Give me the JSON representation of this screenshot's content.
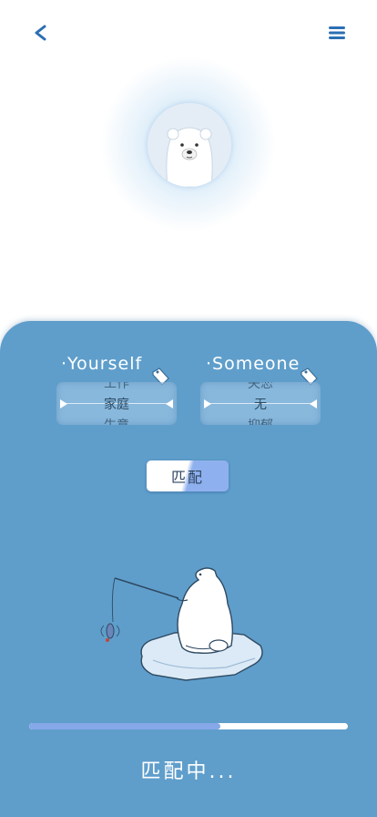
{
  "header": {
    "back_icon": "chevron-left-icon",
    "back_glyph": "<",
    "menu_icon": "hamburger-menu-icon"
  },
  "avatar": {
    "icon": "polar-bear-face-icon"
  },
  "pickers": {
    "yourself": {
      "label": "·Yourself",
      "items": [
        "工作",
        "家庭",
        "生意"
      ],
      "selected": "家庭"
    },
    "someone": {
      "label": "·Someone",
      "items": [
        "失恋",
        "无",
        "抑郁"
      ],
      "selected": "无"
    }
  },
  "match_button": {
    "label": "匹配"
  },
  "illustration": {
    "icon": "polar-bear-fishing-illustration"
  },
  "progress": {
    "value": 0.6
  },
  "status": {
    "text": "匹配中..."
  },
  "colors": {
    "accent": "#2b6fb3",
    "panel": "#5f9ecb",
    "progress_fill": "#86a7e8",
    "progress_track": "#ffffff"
  }
}
